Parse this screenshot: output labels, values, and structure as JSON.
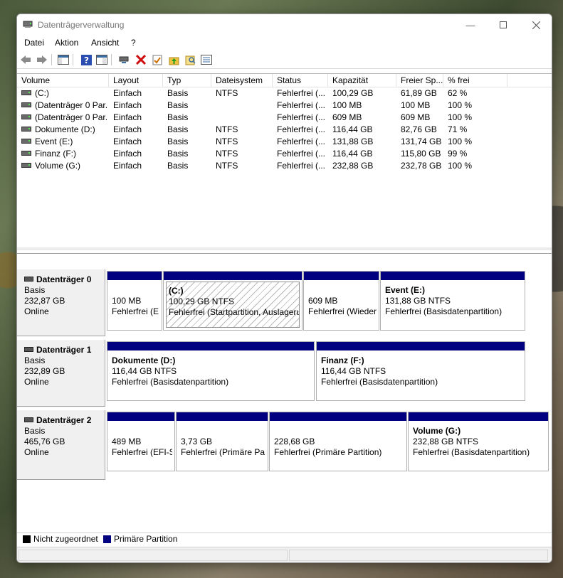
{
  "window": {
    "title": "Datenträgerverwaltung"
  },
  "menu": [
    "Datei",
    "Aktion",
    "Ansicht",
    "?"
  ],
  "toolbar_icons": [
    "back-arrow-icon",
    "forward-arrow-icon",
    "console-tree-icon",
    "help-icon",
    "properties-icon",
    "connect-icon",
    "delete-icon",
    "checklist-icon",
    "folder-up-icon",
    "search-folder-icon",
    "list-icon"
  ],
  "volume_list": {
    "columns": [
      "Volume",
      "Layout",
      "Typ",
      "Dateisystem",
      "Status",
      "Kapazität",
      "Freier Sp...",
      "% frei"
    ],
    "rows": [
      [
        "(C:)",
        "Einfach",
        "Basis",
        "NTFS",
        "Fehlerfrei (...",
        "100,29 GB",
        "61,89 GB",
        "62 %"
      ],
      [
        "(Datenträger 0 Par...",
        "Einfach",
        "Basis",
        "",
        "Fehlerfrei (...",
        "100 MB",
        "100 MB",
        "100 %"
      ],
      [
        "(Datenträger 0 Par...",
        "Einfach",
        "Basis",
        "",
        "Fehlerfrei (...",
        "609 MB",
        "609 MB",
        "100 %"
      ],
      [
        "Dokumente (D:)",
        "Einfach",
        "Basis",
        "NTFS",
        "Fehlerfrei (...",
        "116,44 GB",
        "82,76 GB",
        "71 %"
      ],
      [
        "Event (E:)",
        "Einfach",
        "Basis",
        "NTFS",
        "Fehlerfrei (...",
        "131,88 GB",
        "131,74 GB",
        "100 %"
      ],
      [
        "Finanz (F:)",
        "Einfach",
        "Basis",
        "NTFS",
        "Fehlerfrei (...",
        "116,44 GB",
        "115,80 GB",
        "99 %"
      ],
      [
        "Volume (G:)",
        "Einfach",
        "Basis",
        "NTFS",
        "Fehlerfrei (...",
        "232,88 GB",
        "232,78 GB",
        "100 %"
      ]
    ]
  },
  "disks": [
    {
      "name": "Datenträger 0",
      "type": "Basis",
      "size": "232,87 GB",
      "state": "Online",
      "partitions": [
        {
          "name": "",
          "size": "100 MB",
          "status": "Fehlerfrei (E"
        },
        {
          "name": "(C:)",
          "size": "100,29 GB NTFS",
          "status": "Fehlerfrei (Startpartition, Auslageru"
        },
        {
          "name": "",
          "size": "609 MB",
          "status": "Fehlerfrei (Wieder"
        },
        {
          "name": "Event  (E:)",
          "size": "131,88 GB NTFS",
          "status": "Fehlerfrei (Basisdatenpartition)"
        }
      ]
    },
    {
      "name": "Datenträger 1",
      "type": "Basis",
      "size": "232,89 GB",
      "state": "Online",
      "partitions": [
        {
          "name": "Dokumente  (D:)",
          "size": "116,44 GB NTFS",
          "status": "Fehlerfrei (Basisdatenpartition)"
        },
        {
          "name": "Finanz  (F:)",
          "size": "116,44 GB NTFS",
          "status": "Fehlerfrei (Basisdatenpartition)"
        }
      ]
    },
    {
      "name": "Datenträger 2",
      "type": "Basis",
      "size": "465,76 GB",
      "state": "Online",
      "partitions": [
        {
          "name": "",
          "size": "489 MB",
          "status": "Fehlerfrei (EFI-S"
        },
        {
          "name": "",
          "size": "3,73 GB",
          "status": "Fehlerfrei (Primäre Pa"
        },
        {
          "name": "",
          "size": "228,68 GB",
          "status": "Fehlerfrei (Primäre Partition)"
        },
        {
          "name": "Volume  (G:)",
          "size": "232,88 GB NTFS",
          "status": "Fehlerfrei (Basisdatenpartition)"
        }
      ]
    }
  ],
  "legend": [
    {
      "label": "Nicht zugeordnet",
      "color": "#000000"
    },
    {
      "label": "Primäre Partition",
      "color": "#000080"
    }
  ],
  "colors": {
    "partition_bar": "#000080",
    "unallocated": "#000000"
  }
}
